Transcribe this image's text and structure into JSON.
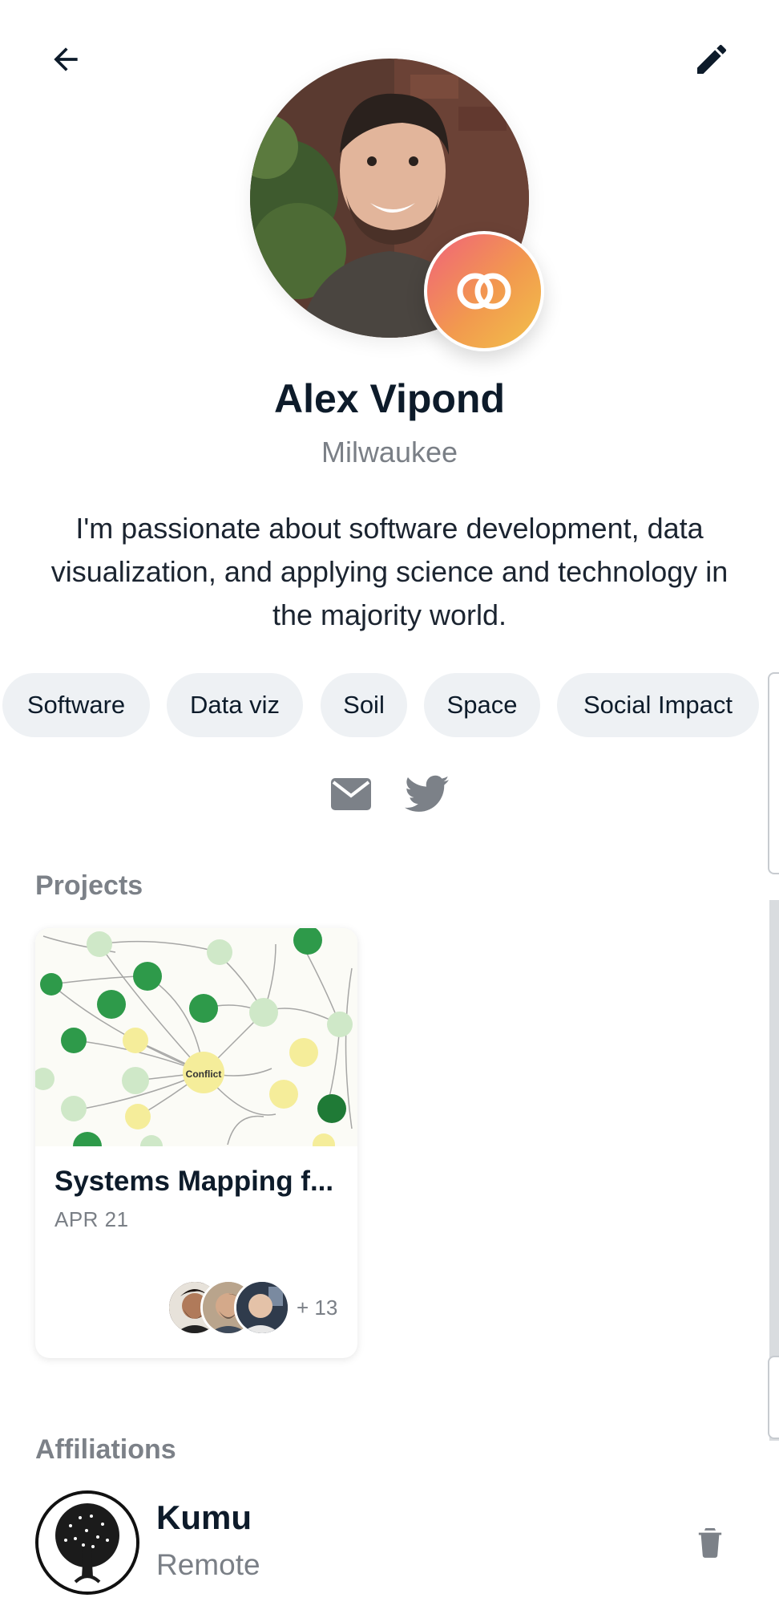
{
  "header": {
    "back_icon": "arrow-left-icon",
    "edit_icon": "pencil-icon"
  },
  "profile": {
    "name": "Alex Vipond",
    "location": "Milwaukee",
    "bio": "I'm passionate about software development, data visualization, and applying science and technology in the majority world.",
    "badge_icon": "interlocking-rings-icon",
    "badge_colors": [
      "#f0627a",
      "#f2c14a"
    ]
  },
  "tags": [
    "Software",
    "Data viz",
    "Soil",
    "Space",
    "Social Impact"
  ],
  "social": {
    "email_icon": "envelope-icon",
    "twitter_icon": "twitter-bird-icon"
  },
  "projects": {
    "title": "Projects",
    "items": [
      {
        "title": "Systems Mapping f...",
        "date": "APR 21",
        "member_count": "+ 13",
        "image_label": "Conflict"
      }
    ]
  },
  "affiliations": {
    "title": "Affiliations",
    "items": [
      {
        "name": "Kumu",
        "location": "Remote",
        "action_icon": "trash-icon"
      }
    ]
  }
}
